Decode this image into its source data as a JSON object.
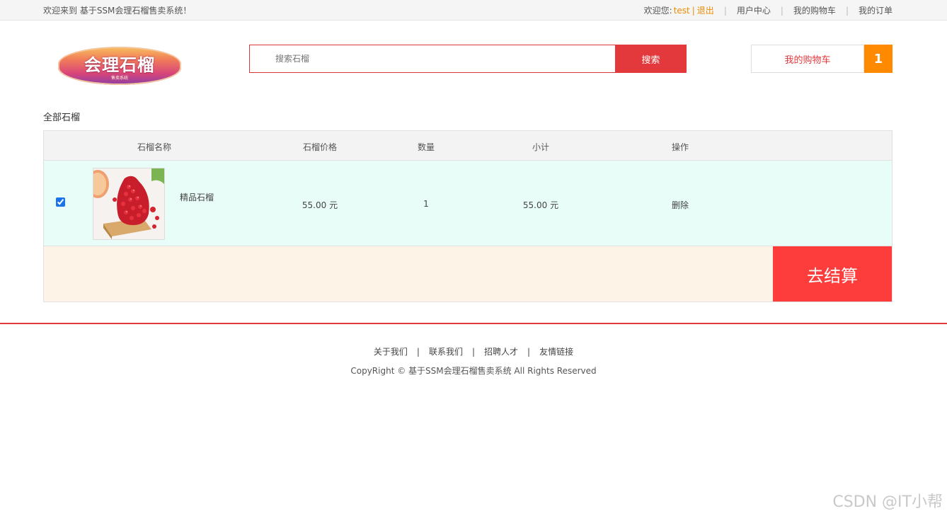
{
  "topbar": {
    "welcome": "欢迎来到 基于SSM会理石榴售卖系统！",
    "greeting": "欢迎您:",
    "username": "test",
    "divider": "|",
    "logout": "退出",
    "sep": "|",
    "user_center": "用户中心",
    "my_cart": "我的购物车",
    "my_orders": "我的订单"
  },
  "logo": {
    "text": "会理石榴",
    "subtitle": "售卖系统"
  },
  "search": {
    "placeholder": "搜索石榴",
    "button": "搜索"
  },
  "cart": {
    "label": "我的购物车",
    "count": "1"
  },
  "section_title": "全部石榴",
  "table": {
    "headers": [
      "石榴名称",
      "石榴价格",
      "数量",
      "小计",
      "操作"
    ],
    "rows": [
      {
        "checked": true,
        "name": "精品石榴",
        "price": "55.00 元",
        "quantity": "1",
        "subtotal": "55.00 元",
        "action": "删除"
      }
    ]
  },
  "checkout": {
    "label": "去结算"
  },
  "footer": {
    "links": [
      "关于我们",
      "联系我们",
      "招聘人才",
      "友情链接"
    ],
    "sep": "|",
    "copyright": "CopyRight © 基于SSM会理石榴售卖系统 All Rights Reserved"
  },
  "watermark": "CSDN @IT小帮",
  "colors": {
    "accent_red": "#e4393c",
    "orange": "#ff8a00",
    "row_bg": "#e8fdf7",
    "footer_bg": "#fef3e7"
  }
}
